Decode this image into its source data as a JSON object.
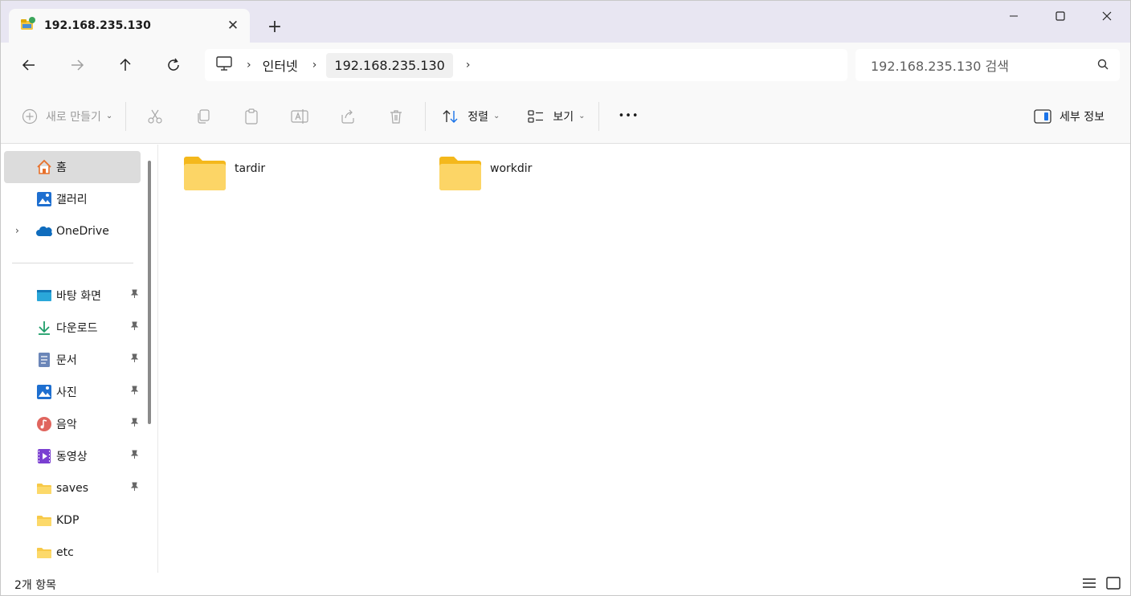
{
  "window": {
    "tab_title": "192.168.235.130",
    "new_tab_symbol": "+",
    "close_tab_symbol": "✕"
  },
  "address": {
    "breadcrumbs": [
      "인터넷",
      "192.168.235.130"
    ],
    "search_placeholder": "192.168.235.130 검색"
  },
  "toolbar": {
    "new_label": "새로 만들기",
    "sort_label": "정렬",
    "view_label": "보기",
    "more_label": "•••",
    "details_label": "세부 정보"
  },
  "sidebar": {
    "items": [
      {
        "label": "홈",
        "icon": "home-icon",
        "selected": true
      },
      {
        "label": "갤러리",
        "icon": "gallery-icon"
      },
      {
        "label": "OneDrive",
        "icon": "onedrive-icon",
        "expandable": true
      },
      {
        "label": "바탕 화면",
        "icon": "desktop-icon",
        "pinned": true
      },
      {
        "label": "다운로드",
        "icon": "download-icon",
        "pinned": true
      },
      {
        "label": "문서",
        "icon": "documents-icon",
        "pinned": true
      },
      {
        "label": "사진",
        "icon": "pictures-icon",
        "pinned": true
      },
      {
        "label": "음악",
        "icon": "music-icon",
        "pinned": true
      },
      {
        "label": "동영상",
        "icon": "videos-icon",
        "pinned": true
      },
      {
        "label": "saves",
        "icon": "folder-icon",
        "pinned": true
      },
      {
        "label": "KDP",
        "icon": "folder-icon"
      },
      {
        "label": "etc",
        "icon": "folder-icon"
      }
    ]
  },
  "files": [
    {
      "name": "tardir",
      "icon": "folder-icon"
    },
    {
      "name": "workdir",
      "icon": "folder-icon"
    }
  ],
  "status": {
    "item_count": "2개 항목"
  },
  "colors": {
    "titlebar_bg": "#e8e6f2",
    "folder_yellow": "#f7c948",
    "accent_blue": "#1a73e8"
  }
}
